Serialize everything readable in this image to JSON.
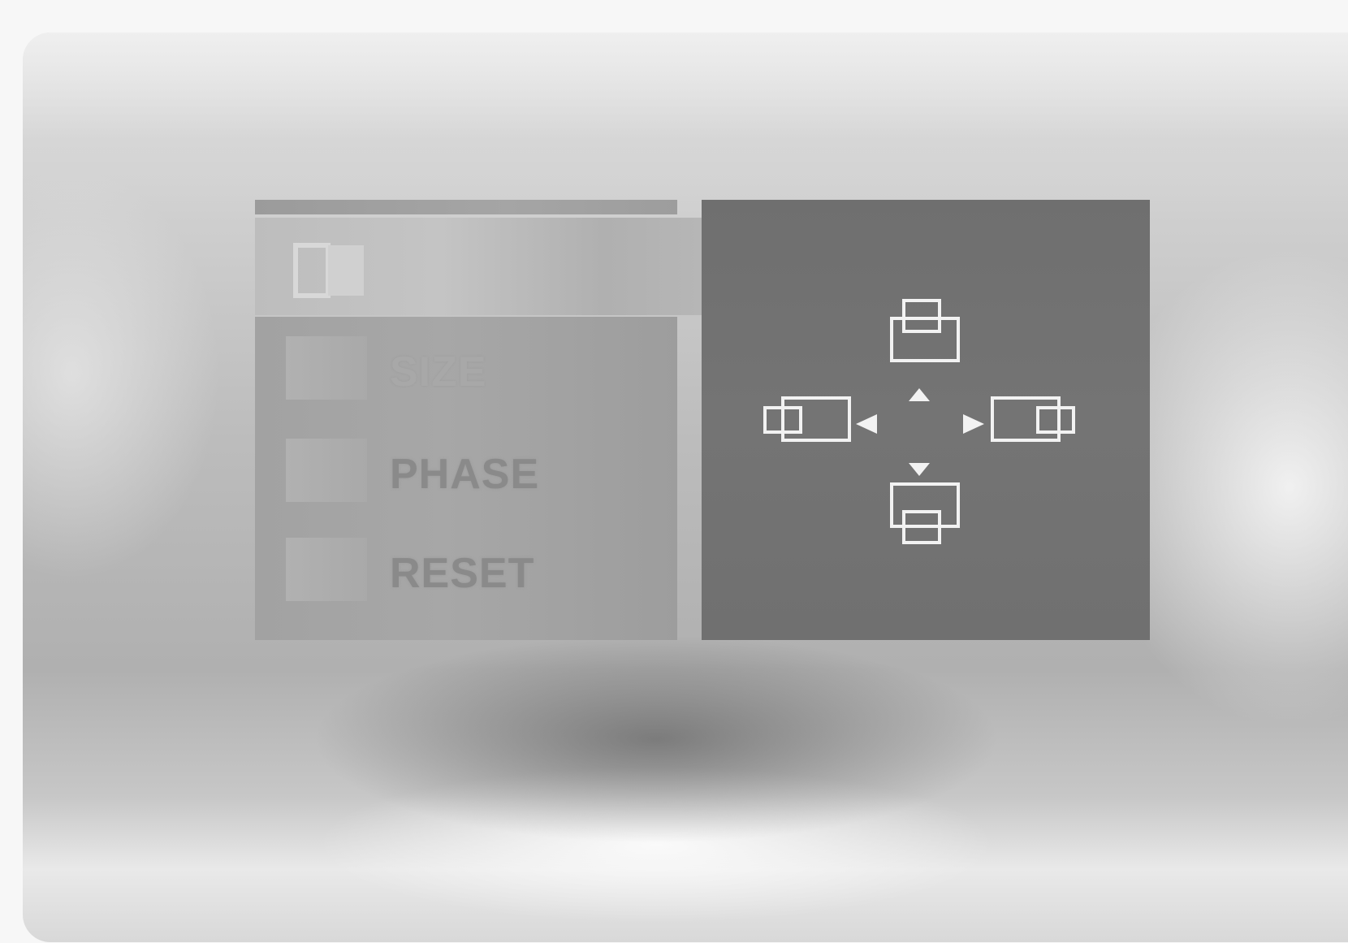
{
  "menu": {
    "selected_icon": "position-icon",
    "items": [
      {
        "label": "SIZE",
        "icon": "size-box-icon"
      },
      {
        "label": "PHASE",
        "icon": "phase-box-icon"
      },
      {
        "label": "RESET",
        "icon": "reset-box-icon"
      }
    ]
  },
  "preview": {
    "icons": [
      "move-up-icon",
      "move-down-icon",
      "move-left-icon",
      "move-right-icon"
    ],
    "colors": {
      "panel": "#717171",
      "stroke": "#f2f2f2",
      "menu": "#a5a5a5"
    }
  }
}
